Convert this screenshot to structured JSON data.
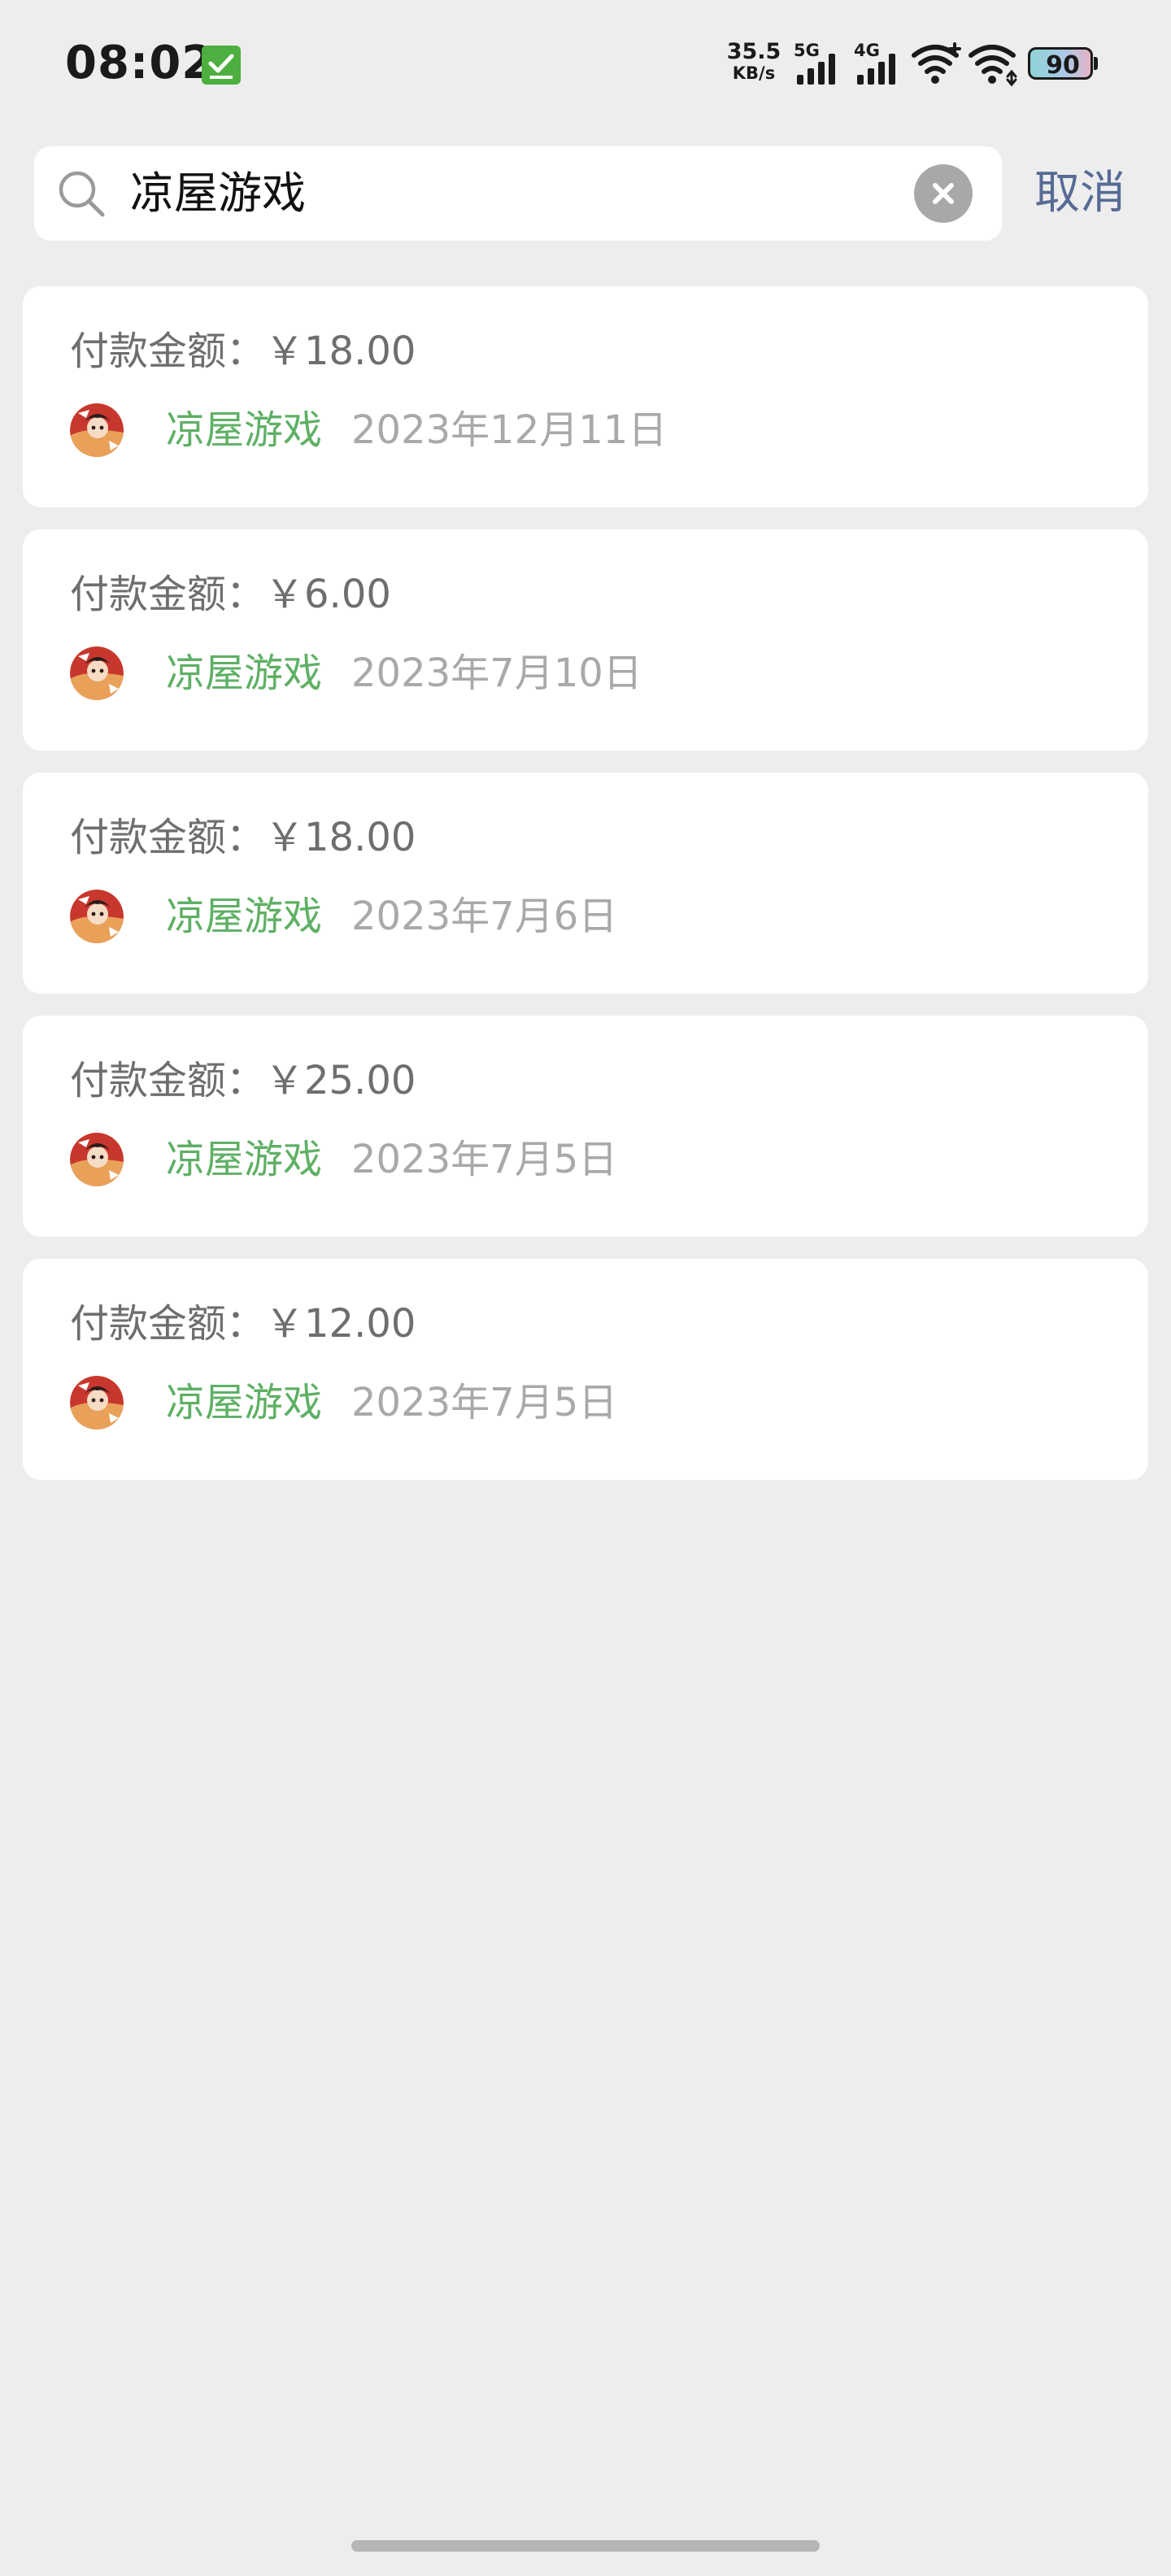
{
  "status_bar": {
    "time": "08:02",
    "net_speed_value": "35.5",
    "net_speed_unit": "KB/s",
    "sim1_label": "5G",
    "sim2_label": "4G",
    "battery_level": "90",
    "notification_icon": "check-square-icon",
    "check_color": "#4caf3f"
  },
  "search": {
    "query": "凉屋游戏",
    "cancel_label": "取消",
    "icons": {
      "search": "search-icon",
      "clear": "clear-circle-icon"
    }
  },
  "colors": {
    "background": "#ededed",
    "card": "#ffffff",
    "merchant_green": "#5fb065",
    "cancel_link": "#576b95",
    "secondary_text": "#a9a9a9"
  },
  "results": [
    {
      "amount_label": "付款金额：",
      "amount": "￥18.00",
      "merchant": "凉屋游戏",
      "date": "2023年12月11日"
    },
    {
      "amount_label": "付款金额：",
      "amount": "￥6.00",
      "merchant": "凉屋游戏",
      "date": "2023年7月10日"
    },
    {
      "amount_label": "付款金额：",
      "amount": "￥18.00",
      "merchant": "凉屋游戏",
      "date": "2023年7月6日"
    },
    {
      "amount_label": "付款金额：",
      "amount": "￥25.00",
      "merchant": "凉屋游戏",
      "date": "2023年7月5日"
    },
    {
      "amount_label": "付款金额：",
      "amount": "￥12.00",
      "merchant": "凉屋游戏",
      "date": "2023年7月5日"
    }
  ]
}
